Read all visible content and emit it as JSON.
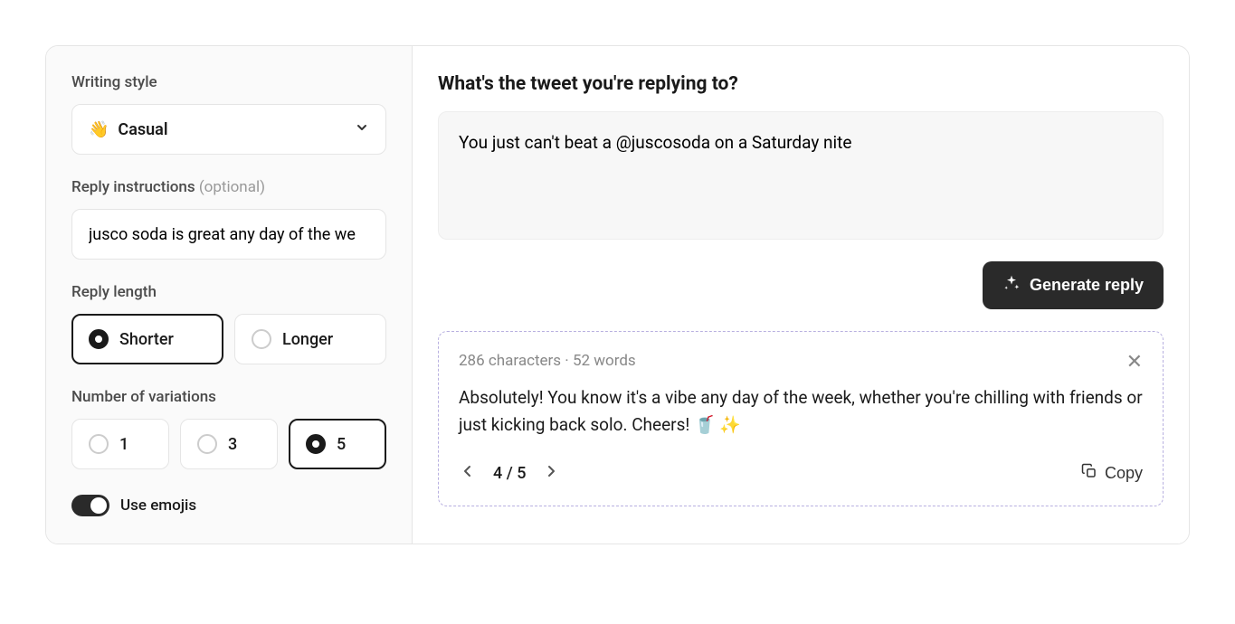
{
  "sidebar": {
    "writing_style_label": "Writing style",
    "writing_style_value": "Casual",
    "writing_style_emoji": "👋",
    "reply_instructions_label": "Reply instructions",
    "reply_instructions_optional": " (optional)",
    "reply_instructions_value": "jusco soda is great any day of the we",
    "reply_length_label": "Reply length",
    "length_options": {
      "shorter": "Shorter",
      "longer": "Longer"
    },
    "variations_label": "Number of variations",
    "variations_options": {
      "one": "1",
      "three": "3",
      "five": "5"
    },
    "use_emojis_label": "Use emojis"
  },
  "main": {
    "heading": "What's the tweet you're replying to?",
    "tweet_text": "You just can't beat a @juscosoda on a Saturday nite",
    "generate_label": "Generate reply",
    "result": {
      "stats": "286 characters · 52 words",
      "reply_text": "Absolutely! You know it's a vibe any day of the week, whether you're chilling with friends or just kicking back solo. Cheers! 🥤 ✨",
      "page_current": "4",
      "page_total": "5",
      "page_display": "4 / 5",
      "copy_label": "Copy"
    }
  }
}
